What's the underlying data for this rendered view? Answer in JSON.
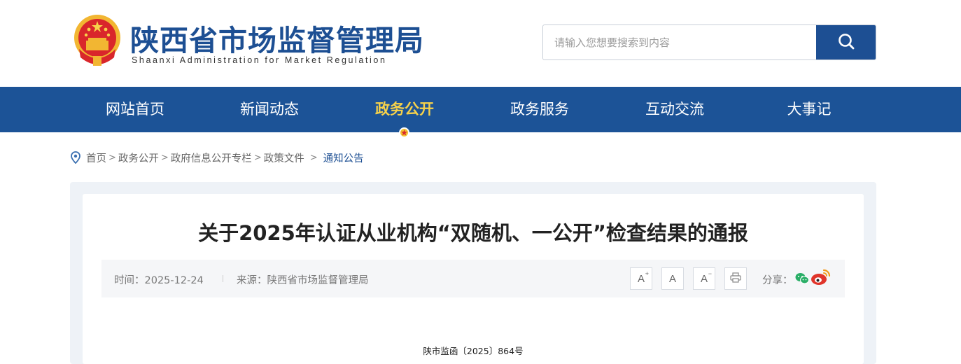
{
  "header": {
    "site_title": "陕西省市场监督管理局",
    "site_subtitle": "Shaanxi Administration for Market Regulation",
    "search": {
      "placeholder": "请输入您想要搜索到内容"
    }
  },
  "nav": {
    "items": [
      {
        "label": "网站首页"
      },
      {
        "label": "新闻动态"
      },
      {
        "label": "政务公开",
        "active": true
      },
      {
        "label": "政务服务"
      },
      {
        "label": "互动交流"
      },
      {
        "label": "大事记"
      }
    ]
  },
  "breadcrumb": {
    "items": [
      "首页",
      "政务公开",
      "政府信息公开专栏",
      "政策文件",
      "通知公告"
    ],
    "separator": ">"
  },
  "article": {
    "title": "关于2025年认证从业机构“双随机、一公开”检查结果的通报",
    "time": "时间：2025-12-24",
    "source": "来源：陕西省市场监督管理局",
    "font_tools": {
      "larger": "A",
      "larger_mark": "+",
      "normal": "A",
      "smaller": "A",
      "smaller_mark": "−"
    },
    "share_label": "分享：",
    "doc_number": "陕市监函〔2025〕864号"
  },
  "colors": {
    "brand_blue": "#1d4f93",
    "nav_blue": "#1c5397",
    "nav_active": "#f7d24a",
    "weibo_red": "#e0352b",
    "wechat_green": "#2aae67"
  },
  "icons": {
    "search": "search-icon",
    "location": "location-pin-icon",
    "print": "printer-icon",
    "wechat": "wechat-icon",
    "weibo": "weibo-icon",
    "emblem": "national-emblem-icon"
  }
}
